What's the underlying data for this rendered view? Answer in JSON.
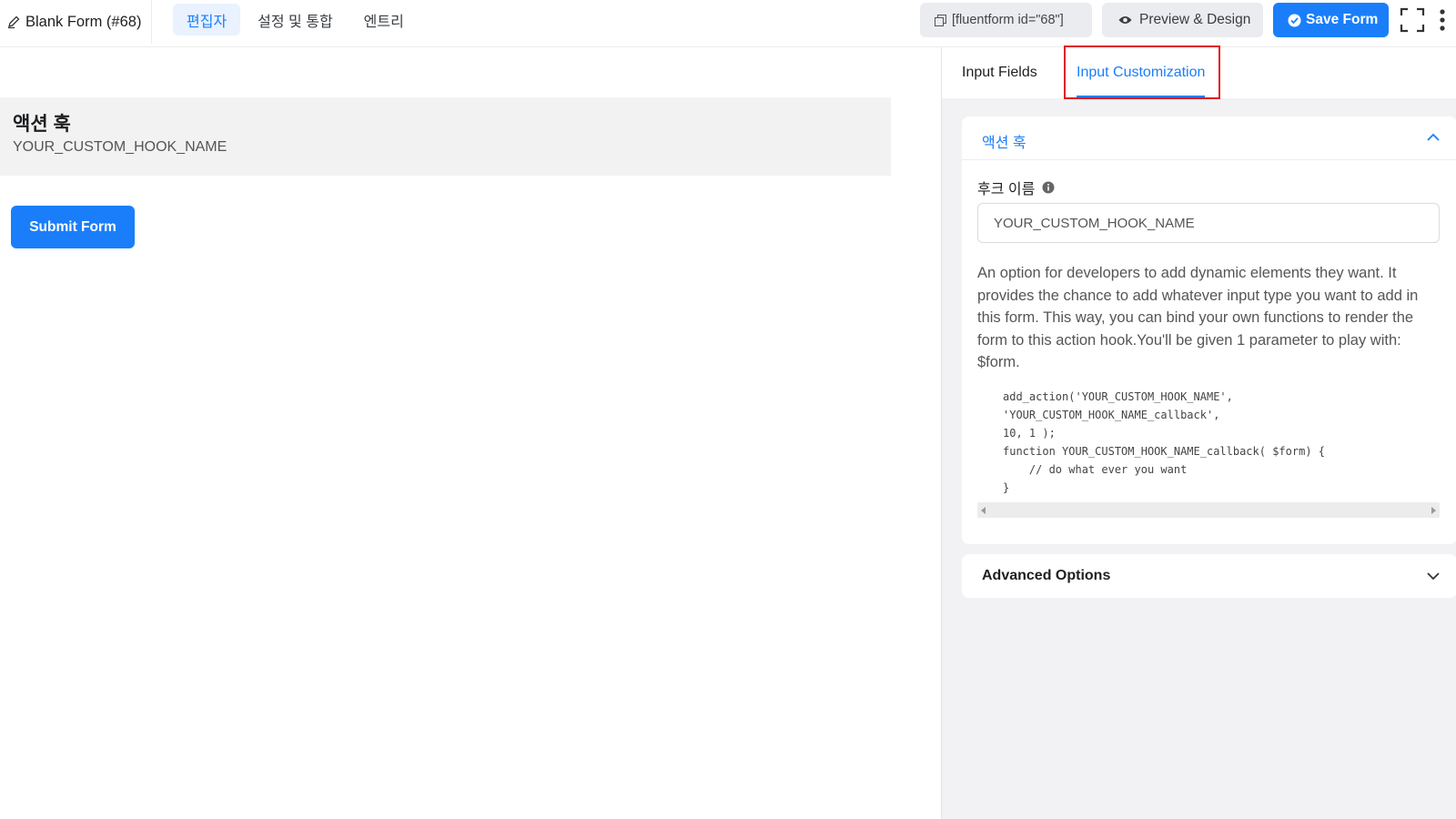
{
  "header": {
    "form_title": "Blank Form (#68)",
    "tabs": [
      {
        "label": "편집자",
        "active": true
      },
      {
        "label": "설정 및 통합",
        "active": false
      },
      {
        "label": "엔트리",
        "active": false
      }
    ],
    "shortcode": "[fluentform id=\"68\"]",
    "preview_label": "Preview & Design",
    "save_label": "Save Form"
  },
  "editor": {
    "block_title": "액션 훅",
    "block_value": "YOUR_CUSTOM_HOOK_NAME",
    "submit_label": "Submit Form"
  },
  "sidebar": {
    "tabs": [
      {
        "label": "Input Fields",
        "active": false
      },
      {
        "label": "Input Customization",
        "active": true
      }
    ],
    "section_title": "액션 훅",
    "field_label": "후크 이름",
    "hook_value": "YOUR_CUSTOM_HOOK_NAME",
    "help_text": "An option for developers to add dynamic elements they want. It provides the chance to add whatever input type you want to add in this form. This way, you can bind your own functions to render the form to this action hook.You'll be given 1 parameter to play with: $form.",
    "code": "add_action('YOUR_CUSTOM_HOOK_NAME',\n'YOUR_CUSTOM_HOOK_NAME_callback',\n10, 1 );\nfunction YOUR_CUSTOM_HOOK_NAME_callback( $form) {\n    // do what ever you want\n}",
    "advanced_label": "Advanced Options"
  },
  "colors": {
    "primary": "#1a7efb",
    "highlight": "#e0161d"
  }
}
